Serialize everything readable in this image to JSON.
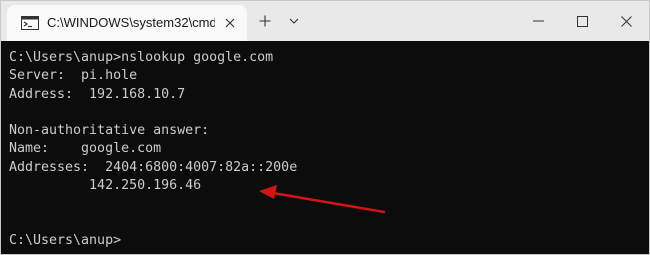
{
  "window": {
    "tab_title": "C:\\WINDOWS\\system32\\cmd.",
    "new_tab_glyph": "+",
    "colors": {
      "titlebar": "#e9e9e9",
      "tab": "#f9f9f9",
      "terminal_bg": "#0c0c0c",
      "terminal_fg": "#cccccc",
      "annotation_arrow": "#d21414"
    },
    "icons": {
      "tab": "terminal-icon",
      "close": "close-icon",
      "dropdown": "chevron-down-icon",
      "minimize": "minimize-icon",
      "maximize": "maximize-icon",
      "window_close": "window-close-icon"
    }
  },
  "terminal": {
    "lines": [
      "C:\\Users\\anup>nslookup google.com",
      "Server:  pi.hole",
      "Address:  192.168.10.7",
      "",
      "Non-authoritative answer:",
      "Name:    google.com",
      "Addresses:  2404:6800:4007:82a::200e",
      "          142.250.196.46",
      "",
      "",
      "C:\\Users\\anup>"
    ]
  }
}
